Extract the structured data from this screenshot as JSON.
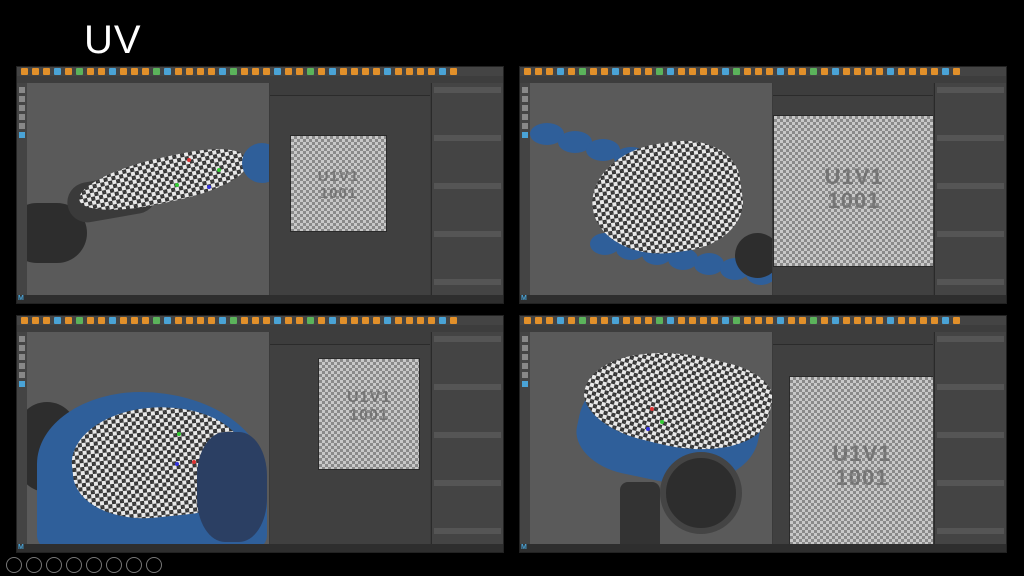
{
  "slide": {
    "title": "UV"
  },
  "uv_tile": {
    "line1": "U1V1",
    "line2": "1001"
  },
  "screens": [
    {
      "id": "top-left",
      "status": ""
    },
    {
      "id": "top-right",
      "status": ""
    },
    {
      "id": "bottom-left",
      "status": ""
    },
    {
      "id": "bottom-right",
      "status": ""
    }
  ],
  "colors": {
    "maya_blue": "#2f5f9a",
    "checker_dark": "#333333",
    "checker_light": "#e8e8e8",
    "panel": "#444444",
    "viewport": "#5a5a5a"
  },
  "icons": [
    "maya-logo-icon",
    "select-tool-icon",
    "move-tool-icon",
    "rotate-tool-icon",
    "scale-tool-icon"
  ],
  "navbar": {
    "buttons": [
      "back-icon",
      "forward-icon",
      "pen-icon",
      "slides-icon",
      "zoom-icon",
      "subtitles-icon",
      "settings-icon",
      "more-icon"
    ]
  }
}
